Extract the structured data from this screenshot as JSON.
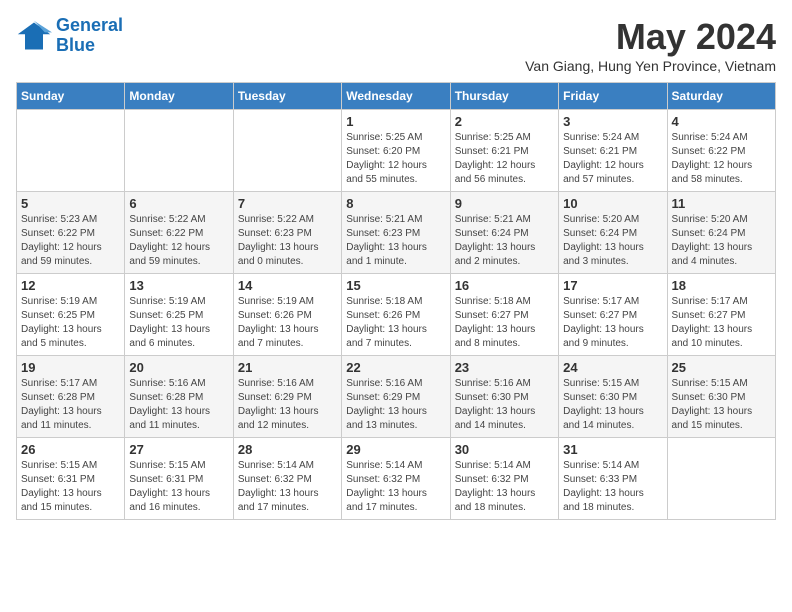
{
  "header": {
    "logo_line1": "General",
    "logo_line2": "Blue",
    "month": "May 2024",
    "location": "Van Giang, Hung Yen Province, Vietnam"
  },
  "weekdays": [
    "Sunday",
    "Monday",
    "Tuesday",
    "Wednesday",
    "Thursday",
    "Friday",
    "Saturday"
  ],
  "weeks": [
    [
      {
        "day": "",
        "info": ""
      },
      {
        "day": "",
        "info": ""
      },
      {
        "day": "",
        "info": ""
      },
      {
        "day": "1",
        "info": "Sunrise: 5:25 AM\nSunset: 6:20 PM\nDaylight: 12 hours\nand 55 minutes."
      },
      {
        "day": "2",
        "info": "Sunrise: 5:25 AM\nSunset: 6:21 PM\nDaylight: 12 hours\nand 56 minutes."
      },
      {
        "day": "3",
        "info": "Sunrise: 5:24 AM\nSunset: 6:21 PM\nDaylight: 12 hours\nand 57 minutes."
      },
      {
        "day": "4",
        "info": "Sunrise: 5:24 AM\nSunset: 6:22 PM\nDaylight: 12 hours\nand 58 minutes."
      }
    ],
    [
      {
        "day": "5",
        "info": "Sunrise: 5:23 AM\nSunset: 6:22 PM\nDaylight: 12 hours\nand 59 minutes."
      },
      {
        "day": "6",
        "info": "Sunrise: 5:22 AM\nSunset: 6:22 PM\nDaylight: 12 hours\nand 59 minutes."
      },
      {
        "day": "7",
        "info": "Sunrise: 5:22 AM\nSunset: 6:23 PM\nDaylight: 13 hours\nand 0 minutes."
      },
      {
        "day": "8",
        "info": "Sunrise: 5:21 AM\nSunset: 6:23 PM\nDaylight: 13 hours\nand 1 minute."
      },
      {
        "day": "9",
        "info": "Sunrise: 5:21 AM\nSunset: 6:24 PM\nDaylight: 13 hours\nand 2 minutes."
      },
      {
        "day": "10",
        "info": "Sunrise: 5:20 AM\nSunset: 6:24 PM\nDaylight: 13 hours\nand 3 minutes."
      },
      {
        "day": "11",
        "info": "Sunrise: 5:20 AM\nSunset: 6:24 PM\nDaylight: 13 hours\nand 4 minutes."
      }
    ],
    [
      {
        "day": "12",
        "info": "Sunrise: 5:19 AM\nSunset: 6:25 PM\nDaylight: 13 hours\nand 5 minutes."
      },
      {
        "day": "13",
        "info": "Sunrise: 5:19 AM\nSunset: 6:25 PM\nDaylight: 13 hours\nand 6 minutes."
      },
      {
        "day": "14",
        "info": "Sunrise: 5:19 AM\nSunset: 6:26 PM\nDaylight: 13 hours\nand 7 minutes."
      },
      {
        "day": "15",
        "info": "Sunrise: 5:18 AM\nSunset: 6:26 PM\nDaylight: 13 hours\nand 7 minutes."
      },
      {
        "day": "16",
        "info": "Sunrise: 5:18 AM\nSunset: 6:27 PM\nDaylight: 13 hours\nand 8 minutes."
      },
      {
        "day": "17",
        "info": "Sunrise: 5:17 AM\nSunset: 6:27 PM\nDaylight: 13 hours\nand 9 minutes."
      },
      {
        "day": "18",
        "info": "Sunrise: 5:17 AM\nSunset: 6:27 PM\nDaylight: 13 hours\nand 10 minutes."
      }
    ],
    [
      {
        "day": "19",
        "info": "Sunrise: 5:17 AM\nSunset: 6:28 PM\nDaylight: 13 hours\nand 11 minutes."
      },
      {
        "day": "20",
        "info": "Sunrise: 5:16 AM\nSunset: 6:28 PM\nDaylight: 13 hours\nand 11 minutes."
      },
      {
        "day": "21",
        "info": "Sunrise: 5:16 AM\nSunset: 6:29 PM\nDaylight: 13 hours\nand 12 minutes."
      },
      {
        "day": "22",
        "info": "Sunrise: 5:16 AM\nSunset: 6:29 PM\nDaylight: 13 hours\nand 13 minutes."
      },
      {
        "day": "23",
        "info": "Sunrise: 5:16 AM\nSunset: 6:30 PM\nDaylight: 13 hours\nand 14 minutes."
      },
      {
        "day": "24",
        "info": "Sunrise: 5:15 AM\nSunset: 6:30 PM\nDaylight: 13 hours\nand 14 minutes."
      },
      {
        "day": "25",
        "info": "Sunrise: 5:15 AM\nSunset: 6:30 PM\nDaylight: 13 hours\nand 15 minutes."
      }
    ],
    [
      {
        "day": "26",
        "info": "Sunrise: 5:15 AM\nSunset: 6:31 PM\nDaylight: 13 hours\nand 15 minutes."
      },
      {
        "day": "27",
        "info": "Sunrise: 5:15 AM\nSunset: 6:31 PM\nDaylight: 13 hours\nand 16 minutes."
      },
      {
        "day": "28",
        "info": "Sunrise: 5:14 AM\nSunset: 6:32 PM\nDaylight: 13 hours\nand 17 minutes."
      },
      {
        "day": "29",
        "info": "Sunrise: 5:14 AM\nSunset: 6:32 PM\nDaylight: 13 hours\nand 17 minutes."
      },
      {
        "day": "30",
        "info": "Sunrise: 5:14 AM\nSunset: 6:32 PM\nDaylight: 13 hours\nand 18 minutes."
      },
      {
        "day": "31",
        "info": "Sunrise: 5:14 AM\nSunset: 6:33 PM\nDaylight: 13 hours\nand 18 minutes."
      },
      {
        "day": "",
        "info": ""
      }
    ]
  ]
}
